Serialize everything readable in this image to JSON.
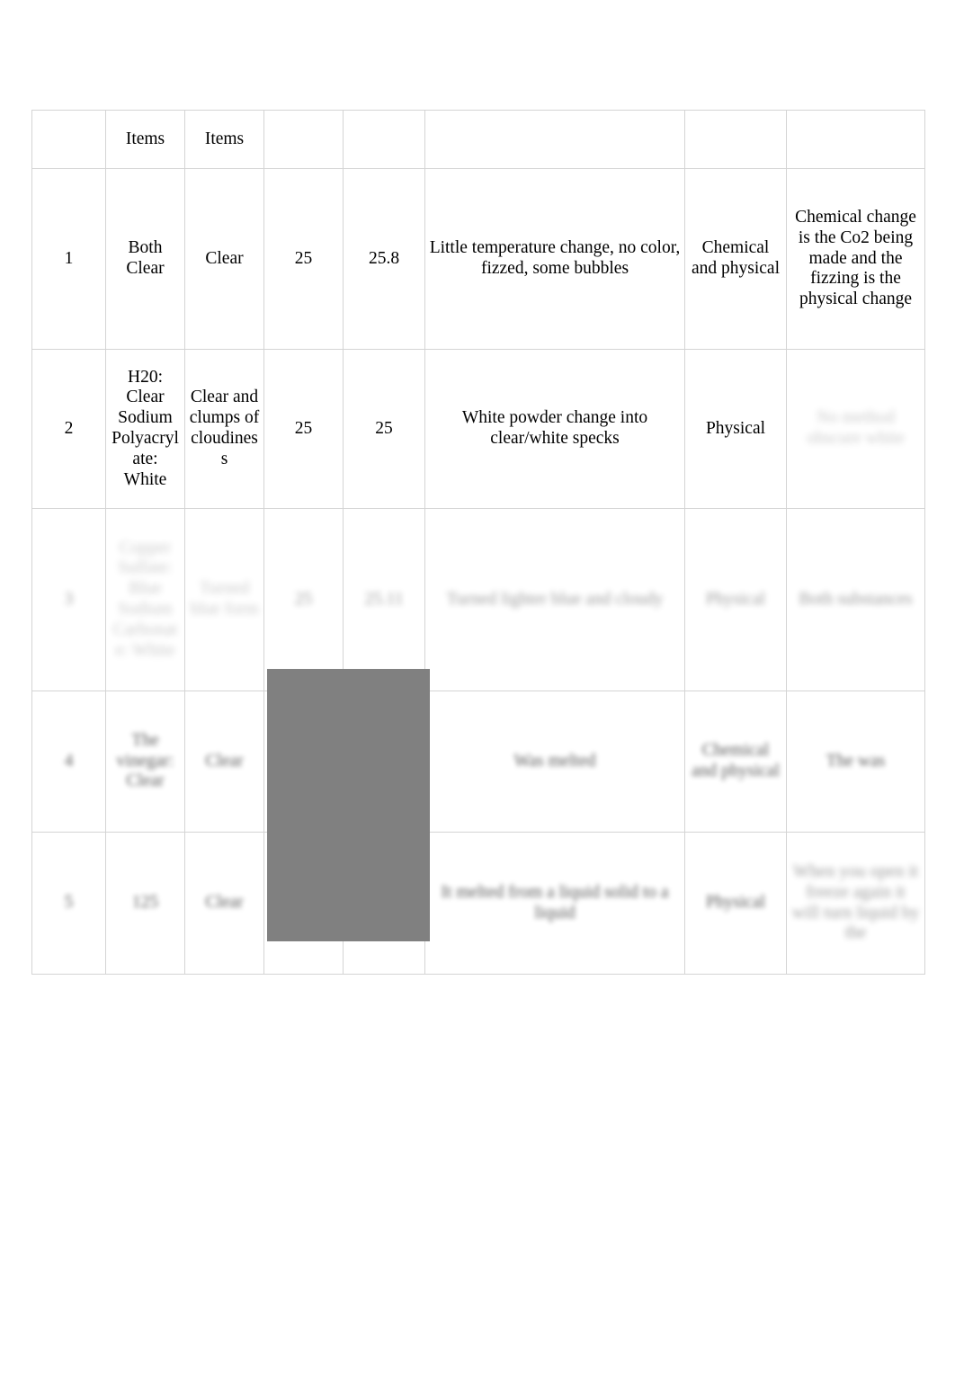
{
  "document": {
    "type": "lab-observation-table",
    "background_color": "#ffffff",
    "table_border_color": "#d4d4d4",
    "redaction_color": "#808080"
  },
  "table": {
    "header_row": [
      "",
      "Items",
      "Items",
      "",
      "",
      "",
      "",
      ""
    ],
    "rows": [
      {
        "id": "row-1",
        "legible": true,
        "cells": [
          "1",
          "Both Clear",
          "Clear",
          "25",
          "25.8",
          "Little temperature change, no color, fizzed, some bubbles",
          "Chemical and physical",
          "Chemical change is the Co2 being made and the fizzing is the physical change"
        ]
      },
      {
        "id": "row-2",
        "legible": true,
        "cells": [
          "2",
          "H20: Clear Sodium Polyacrylate: White",
          "Clear and clumps of cloudiness",
          "25",
          "25",
          "White powder change into clear/white specks",
          "Physical",
          "No method obscure white"
        ]
      },
      {
        "id": "row-3",
        "legible": false,
        "cells": [
          "3",
          "Copper Sulfate: Blue Sodium Carbonate: White",
          "Turned blue form",
          "25",
          "25.11",
          "Turned lighter blue and cloudy",
          "Physical",
          "Both substances"
        ]
      },
      {
        "id": "row-4",
        "legible": false,
        "cells": [
          "4",
          "The vinegar: Clear",
          "Clear",
          "",
          "",
          "Was melted",
          "Chemical and physical",
          "The was"
        ]
      },
      {
        "id": "row-5",
        "legible": false,
        "cells": [
          "5",
          "125",
          "Clear",
          "",
          "",
          "It melted from a liquid solid to a liquid",
          "Physical",
          "When you open it freeze again it will turn liquid by the"
        ]
      }
    ]
  }
}
